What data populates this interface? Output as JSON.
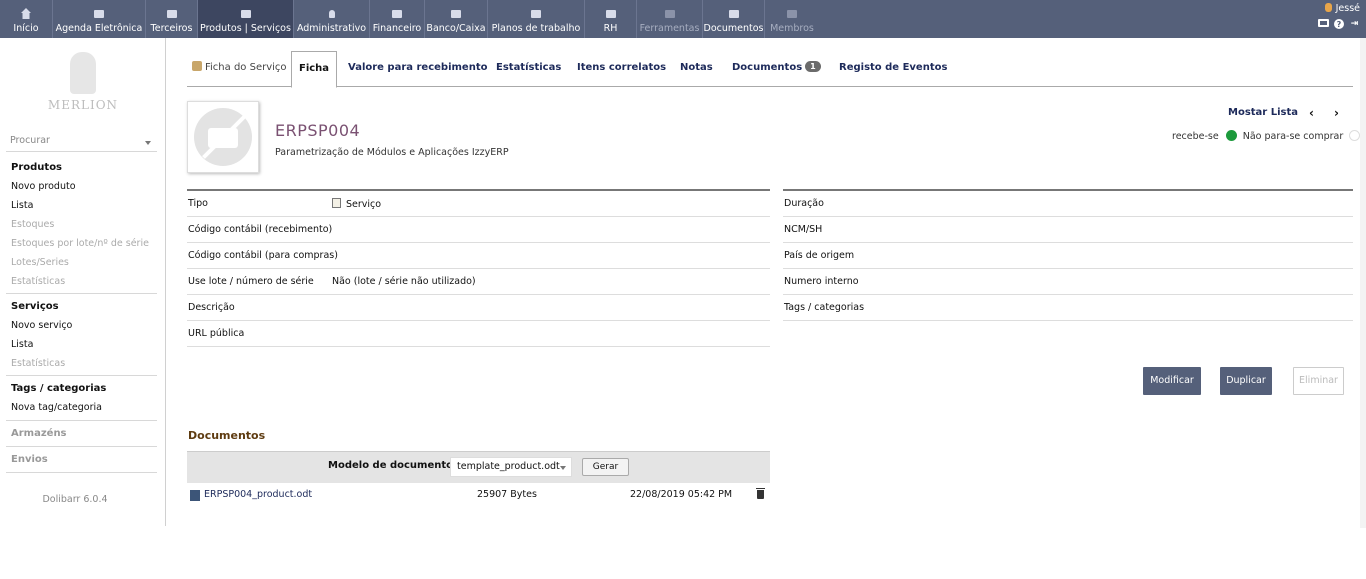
{
  "topmenu": [
    {
      "label": "Início",
      "icon": "home-icon",
      "state": "normal"
    },
    {
      "label": "Agenda Eletrônica",
      "icon": "agenda-icon",
      "state": "normal"
    },
    {
      "label": "Terceiros",
      "icon": "buildings-icon",
      "state": "normal"
    },
    {
      "label": "Produtos | Serviços",
      "icon": "products-icon",
      "state": "active"
    },
    {
      "label": "Administrativo",
      "icon": "admin-icon",
      "state": "normal"
    },
    {
      "label": "Financeiro",
      "icon": "finance-icon",
      "state": "normal"
    },
    {
      "label": "Banco/Caixa",
      "icon": "bank-icon",
      "state": "normal"
    },
    {
      "label": "Planos de trabalho",
      "icon": "project-icon",
      "state": "normal"
    },
    {
      "label": "RH",
      "icon": "hr-icon",
      "state": "normal"
    },
    {
      "label": "Ferramentas",
      "icon": "tools-icon",
      "state": "disabled"
    },
    {
      "label": "Documentos",
      "icon": "documents-icon",
      "state": "normal"
    },
    {
      "label": "Membros",
      "icon": "members-icon",
      "state": "disabled"
    }
  ],
  "user": {
    "name": "Jessé"
  },
  "sidebar": {
    "logo_text": "MERLION",
    "search_placeholder": "Procurar",
    "sections": [
      {
        "title": "Produtos",
        "title_muted": false,
        "items": [
          {
            "label": "Novo produto",
            "muted": false
          },
          {
            "label": "Lista",
            "muted": false
          },
          {
            "label": "Estoques",
            "muted": true
          },
          {
            "label": "Estoques por lote/nº de série",
            "muted": true
          },
          {
            "label": "Lotes/Series",
            "muted": true
          },
          {
            "label": "Estatísticas",
            "muted": true
          }
        ]
      },
      {
        "title": "Serviços",
        "title_muted": false,
        "items": [
          {
            "label": "Novo serviço",
            "muted": false
          },
          {
            "label": "Lista",
            "muted": false
          },
          {
            "label": "Estatísticas",
            "muted": true
          }
        ]
      },
      {
        "title": "Tags / categorias",
        "title_muted": false,
        "items": [
          {
            "label": "Nova tag/categoria",
            "muted": false
          }
        ]
      },
      {
        "title": "Armazéns",
        "title_muted": true,
        "items": []
      },
      {
        "title": "Envios",
        "title_muted": true,
        "items": []
      }
    ],
    "version": "Dolibarr 6.0.4"
  },
  "tabs": [
    {
      "label": "Ficha do Serviço"
    },
    {
      "label": "Ficha"
    },
    {
      "label": "Valore para recebimento"
    },
    {
      "label": "Estatísticas"
    },
    {
      "label": "Itens correlatos"
    },
    {
      "label": "Notas"
    },
    {
      "label": "Documentos",
      "badge": "1"
    },
    {
      "label": "Registo de Eventos"
    }
  ],
  "product": {
    "ref": "ERPSP004",
    "label": "Parametrização de Módulos e Aplicações IzzyERP",
    "show_list": "Mostar Lista",
    "status_sell": "recebe-se",
    "status_buy": "Não para-se comprar",
    "status_sell_color": "#1c9a3c"
  },
  "fields_left": [
    {
      "label": "Tipo",
      "value": "Serviço",
      "icon": "service-doc-icon"
    },
    {
      "label": "Código contábil (recebimento)",
      "value": ""
    },
    {
      "label": "Código contábil (para compras)",
      "value": ""
    },
    {
      "label": "Use lote / número de série",
      "value": "Não (lote / série não utilizado)"
    },
    {
      "label": "Descrição",
      "value": ""
    },
    {
      "label": "URL pública",
      "value": ""
    }
  ],
  "fields_right": [
    {
      "label": "Duração",
      "value": ""
    },
    {
      "label": "NCM/SH",
      "value": ""
    },
    {
      "label": "País de origem",
      "value": ""
    },
    {
      "label": "Numero interno",
      "value": ""
    },
    {
      "label": "Tags / categorias",
      "value": ""
    }
  ],
  "actions": {
    "modify": "Modificar",
    "duplicate": "Duplicar",
    "delete": "Eliminar"
  },
  "documents": {
    "title": "Documentos",
    "model_label": "Modelo de documento",
    "model_value": "template_product.odt",
    "generate": "Gerar",
    "files": [
      {
        "name": "ERPSP004_product.odt",
        "size": "25907 Bytes",
        "date": "22/08/2019 05:42 PM"
      }
    ]
  },
  "colors": {
    "topbar": "#55607a",
    "accent": "#1d2a5a",
    "ref": "#7a5172"
  }
}
